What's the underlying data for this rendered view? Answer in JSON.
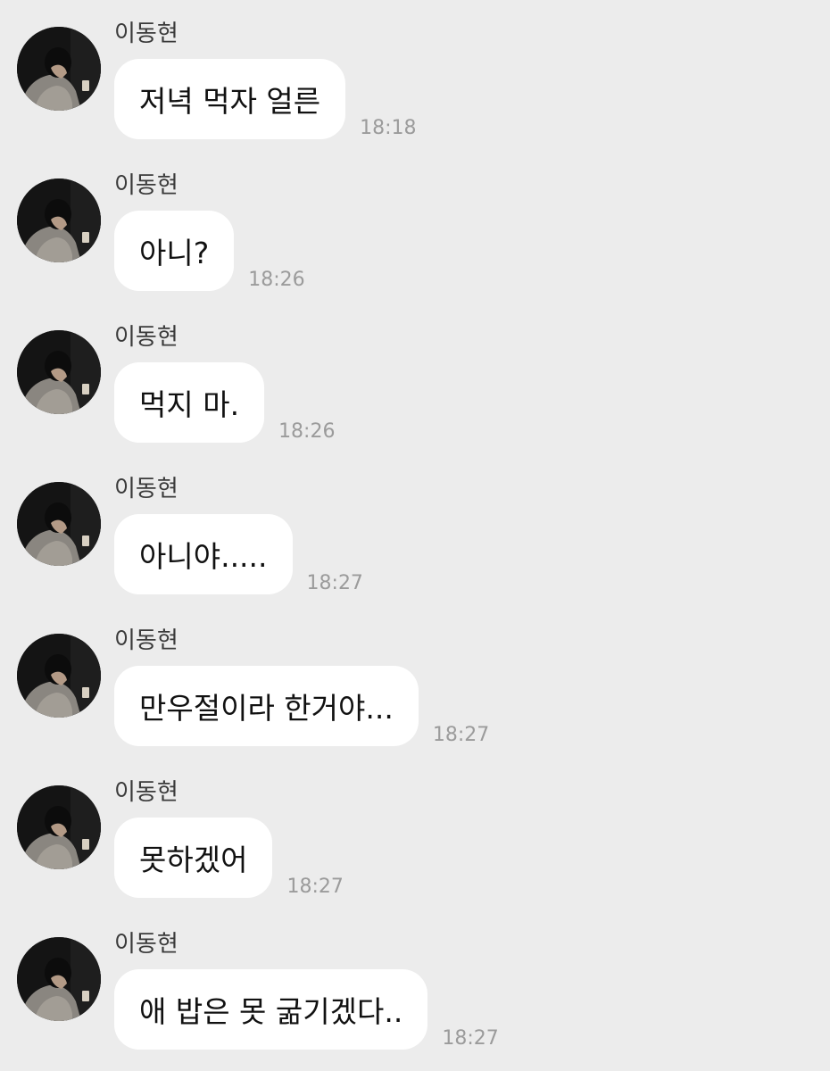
{
  "messages": [
    {
      "sender": "이동현",
      "text": "저녁 먹자 얼른",
      "time": "18:18"
    },
    {
      "sender": "이동현",
      "text": "아니?",
      "time": "18:26"
    },
    {
      "sender": "이동현",
      "text": "먹지 마.",
      "time": "18:26"
    },
    {
      "sender": "이동현",
      "text": "아니야.....",
      "time": "18:27"
    },
    {
      "sender": "이동현",
      "text": "만우절이라 한거야...",
      "time": "18:27"
    },
    {
      "sender": "이동현",
      "text": "못하겠어",
      "time": "18:27"
    },
    {
      "sender": "이동현",
      "text": "애 밥은 못 굶기겠다..",
      "time": "18:27"
    }
  ],
  "colors": {
    "background": "#ececec",
    "bubble": "#ffffff",
    "time_text": "#9b9b9b"
  },
  "icons": {
    "avatar": "profile-photo"
  }
}
